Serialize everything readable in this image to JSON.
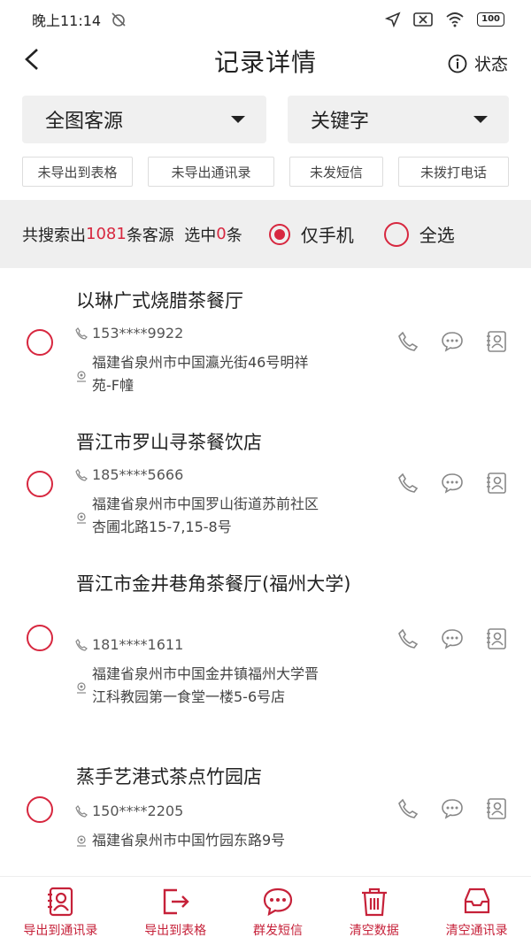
{
  "status_bar": {
    "time": "晚上11:14",
    "battery": "100"
  },
  "header": {
    "title": "记录详情",
    "state_label": "状态"
  },
  "filters": {
    "source": "全图客源",
    "keyword": "关键字"
  },
  "chips": [
    "未导出到表格",
    "未导出通讯录",
    "未发短信",
    "未拨打电话"
  ],
  "summary": {
    "prefix": "共搜索出",
    "count": "1081",
    "mid": "条客源  选中",
    "selected": "0",
    "suffix": "条",
    "phone_only": "仅手机",
    "select_all": "全选"
  },
  "items": [
    {
      "name": "以琳广式烧腊茶餐厅",
      "phone": "153****9922",
      "address": [
        "福建省泉州市中国瀛光街46号明祥",
        "苑-F幢"
      ]
    },
    {
      "name": "晋江市罗山寻茶餐饮店",
      "phone": "185****5666",
      "address": [
        "福建省泉州市中国罗山街道苏前社区",
        "杏圃北路15-7,15-8号"
      ]
    },
    {
      "name": "晋江市金井巷角茶餐厅(福州大学)",
      "phone": "181****1611",
      "address": [
        "福建省泉州市中国金井镇福州大学晋",
        "江科教园第一食堂一楼5-6号店"
      ]
    },
    {
      "name": "蒸手艺港式茶点竹园店",
      "phone": "150****2205",
      "address": [
        "福建省泉州市中国竹园东路9号",
        ""
      ]
    }
  ],
  "bottom_tabs": [
    "导出到通讯录",
    "导出到表格",
    "群发短信",
    "清空数据",
    "清空通讯录"
  ],
  "colors": {
    "accent": "#d7273f"
  }
}
